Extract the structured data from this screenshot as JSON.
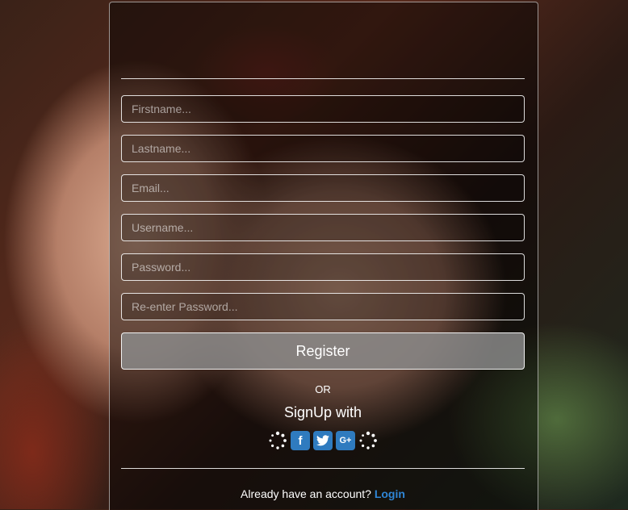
{
  "form": {
    "fields": [
      {
        "name": "firstname",
        "placeholder": "Firstname..."
      },
      {
        "name": "lastname",
        "placeholder": "Lastname..."
      },
      {
        "name": "email",
        "placeholder": "Email..."
      },
      {
        "name": "username",
        "placeholder": "Username..."
      },
      {
        "name": "password",
        "placeholder": "Password..."
      },
      {
        "name": "confirm",
        "placeholder": "Re-enter Password..."
      }
    ],
    "register_label": "Register"
  },
  "social": {
    "or_label": "OR",
    "signup_label": "SignUp with",
    "icons": [
      "spinner-icon",
      "facebook-icon",
      "twitter-icon",
      "google-plus-icon",
      "spinner-icon"
    ],
    "facebook_glyph": "f",
    "google_glyph": "G+"
  },
  "footer": {
    "prompt": "Already have an account?",
    "login_label": "Login"
  },
  "colors": {
    "accent": "#2f7bbf",
    "link": "#2f86d6"
  }
}
